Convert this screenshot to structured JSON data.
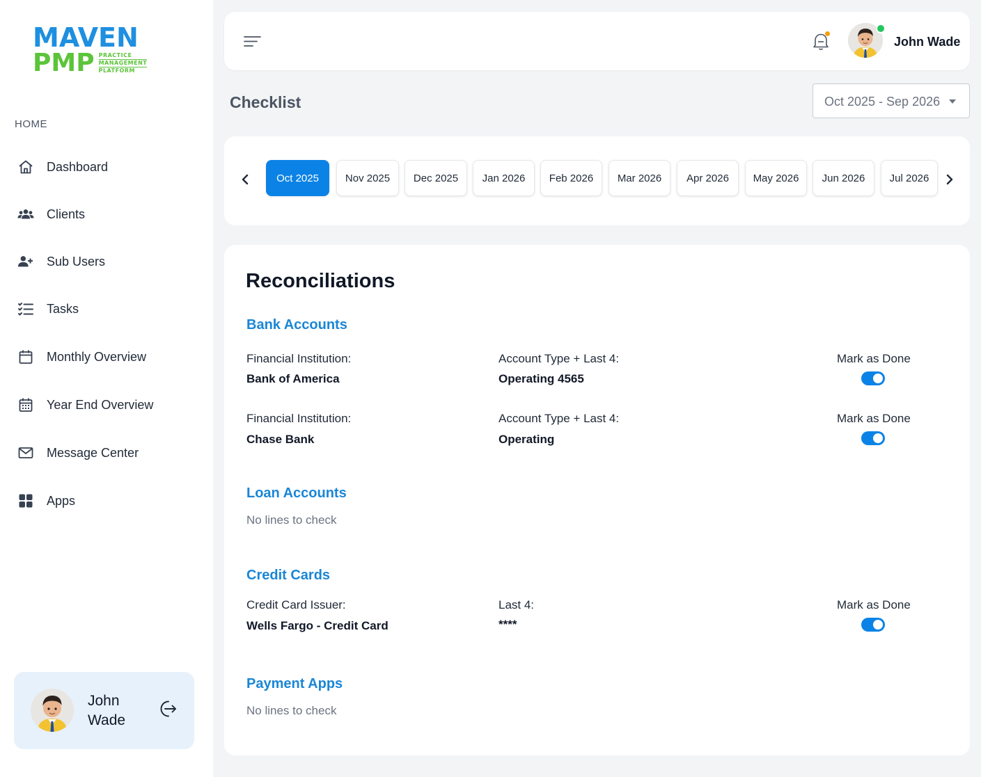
{
  "brand": {
    "line1": "MAVEN",
    "line2": "PMP",
    "tagline": [
      "PRACTICE",
      "MANAGEMENT",
      "PLATFORM"
    ],
    "colors": {
      "blue": "#1f8fe0",
      "green": "#5cc43a"
    }
  },
  "sidebar": {
    "section_label": "HOME",
    "items": [
      {
        "label": "Dashboard",
        "icon": "home-icon"
      },
      {
        "label": "Clients",
        "icon": "users-group-icon"
      },
      {
        "label": "Sub Users",
        "icon": "user-plus-icon"
      },
      {
        "label": "Tasks",
        "icon": "checklist-icon"
      },
      {
        "label": "Monthly Overview",
        "icon": "calendar-icon"
      },
      {
        "label": "Year End Overview",
        "icon": "calendar-grid-icon"
      },
      {
        "label": "Message Center",
        "icon": "mail-icon"
      },
      {
        "label": "Apps",
        "icon": "apps-grid-icon"
      }
    ],
    "user": {
      "name": "John Wade",
      "action_icon": "logout-icon"
    }
  },
  "topbar": {
    "menu_icon": "menu-icon",
    "notification_icon": "bell-icon",
    "user_name": "John Wade",
    "status_color": "#22c55e"
  },
  "page": {
    "title": "Checklist",
    "range": "Oct 2025 - Sep 2026"
  },
  "months": {
    "items": [
      "Oct 2025",
      "Nov 2025",
      "Dec 2025",
      "Jan 2026",
      "Feb 2026",
      "Mar 2026",
      "Apr 2026",
      "May 2026",
      "Jun 2026",
      "Jul 2026"
    ],
    "active": "Oct 2025",
    "accent": "#0b83e6"
  },
  "reconciliations": {
    "title": "Reconciliations",
    "bank": {
      "title": "Bank Accounts",
      "rows": [
        {
          "inst_label": "Financial Institution:",
          "inst_value": "Bank of America",
          "acct_label": "Account Type + Last 4:",
          "acct_value": "Operating 4565",
          "done_label": "Mark as Done",
          "done": true
        },
        {
          "inst_label": "Financial Institution:",
          "inst_value": "Chase Bank",
          "acct_label": "Account Type + Last 4:",
          "acct_value": "Operating",
          "done_label": "Mark as Done",
          "done": true
        }
      ]
    },
    "loan": {
      "title": "Loan Accounts",
      "empty": "No lines to check"
    },
    "credit": {
      "title": "Credit Cards",
      "rows": [
        {
          "inst_label": "Credit Card Issuer:",
          "inst_value": "Wells Fargo - Credit Card",
          "acct_label": "Last 4:",
          "acct_value": "****",
          "done_label": "Mark as Done",
          "done": true
        }
      ]
    },
    "payment": {
      "title": "Payment Apps",
      "empty": "No lines to check"
    }
  }
}
